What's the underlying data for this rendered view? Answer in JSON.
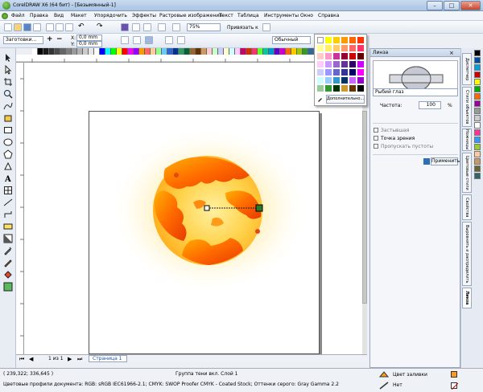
{
  "window": {
    "title": "CorelDRAW X6 (64 бит) - [Безымянный-1]",
    "minimize": "–",
    "maximize": "□",
    "close": "✕"
  },
  "menu": [
    "Файл",
    "Правка",
    "Вид",
    "Макет",
    "Упорядочить",
    "Эффекты",
    "Растровые изображения",
    "Текст",
    "Таблица",
    "Инструменты",
    "Окно",
    "Справка"
  ],
  "toolbar": {
    "zoom": "75%",
    "snap_label": "Привязать к"
  },
  "property_bar": {
    "paper": "Заготовки...",
    "x_label": "X:",
    "x_value": "0,0 mm",
    "y_label": "Y:",
    "y_value": "0,0 mm",
    "outline": "Обычный"
  },
  "docked_palette": {
    "more_button": "Дополнительно..."
  },
  "lens_panel": {
    "title": "Линза",
    "lens_type": "Рыбий глаз",
    "rate_label": "Частота:",
    "rate_value": "100",
    "rate_unit": "%",
    "freeze": "Застывшая",
    "viewpoint": "Точка зрения",
    "remove_face": "Пропускать пустоты",
    "apply_button": "Применить"
  },
  "docker_tabs": [
    "Диспетчер",
    "Стили объектов",
    "Ножницы",
    "Цветовые стили",
    "Свойства",
    "Выровнять и распределить",
    "Линза"
  ],
  "page_nav": {
    "page_count": "1 из 1",
    "page_tab": "Страница 1"
  },
  "status": {
    "coords": "( 239,322; 336,645 )",
    "selection": "Группа тени вкл. Слой 1",
    "color_profiles": "Цветовые профили документа: RGB: sRGB IEC61966-2.1; CMYK: SWOP Proofer CMYK - Coated Stock; Оттенки серого: Gray Gamma 2.2",
    "fill_label": "Цвет заливки",
    "outline_label": "Нет"
  },
  "colors": {
    "accent": "#2f6db5",
    "fire_orange": "#ff7a00",
    "glow": "#ffe066"
  }
}
